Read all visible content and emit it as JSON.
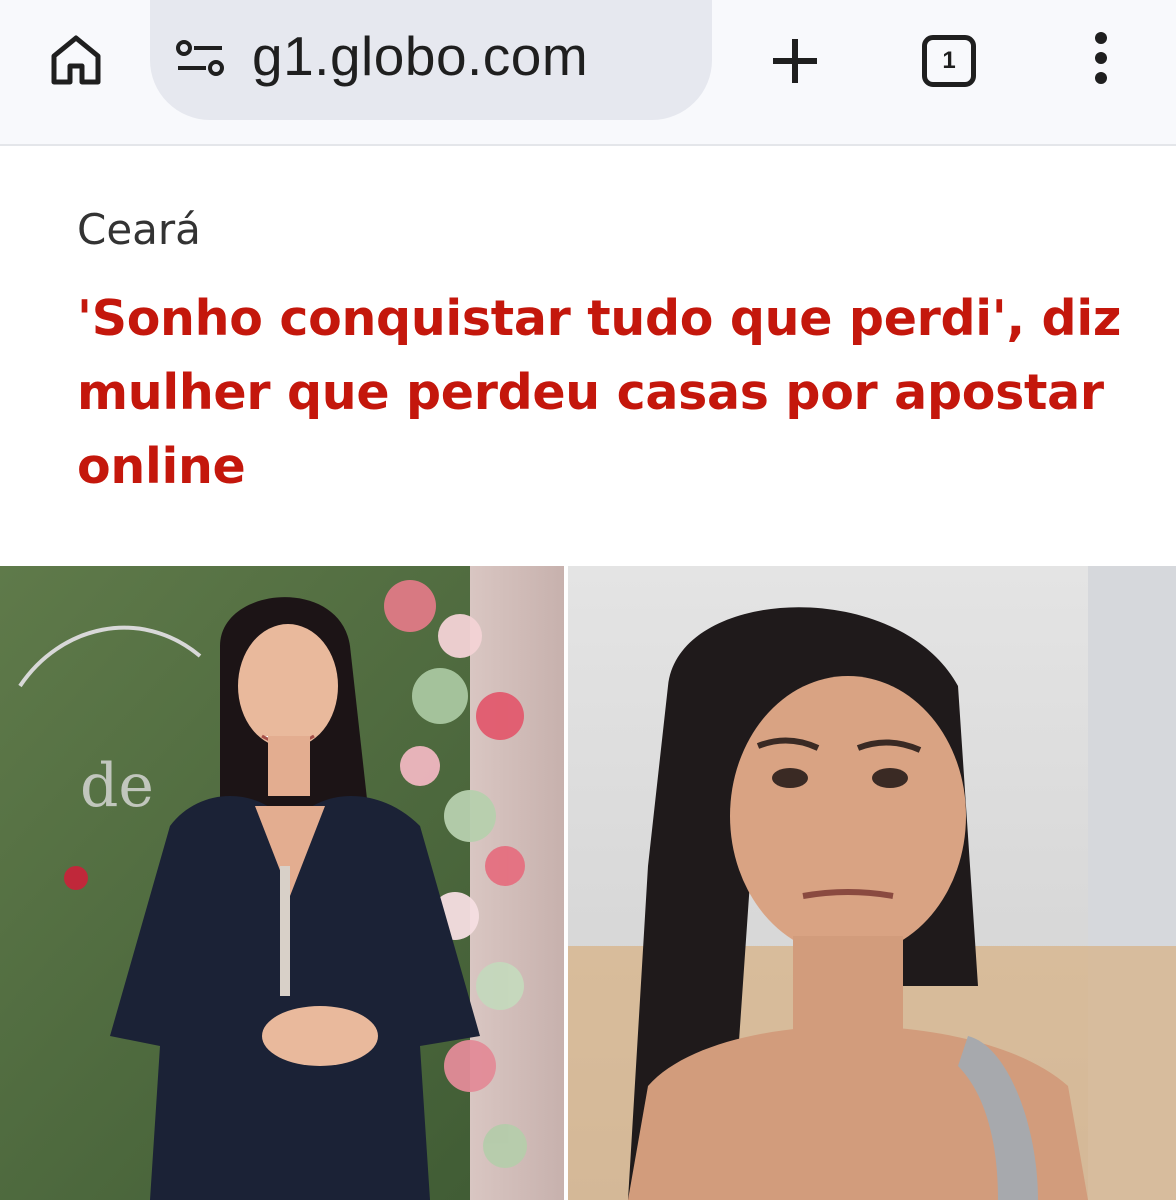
{
  "browser": {
    "url": "g1.globo.com",
    "tab_count": "1",
    "icons": [
      "home-icon",
      "site-settings-icon",
      "new-tab-icon",
      "tab-switcher-icon",
      "more-menu-icon"
    ]
  },
  "article": {
    "category": "Ceará",
    "headline": "'Sonho conquistar tudo que perdi', diz mulher que perdeu casas por apostar online"
  },
  "colors": {
    "headline": "#c4170c",
    "toolbar_bg": "#f8f9fc",
    "urlbar_bg": "#e6e8ef"
  }
}
